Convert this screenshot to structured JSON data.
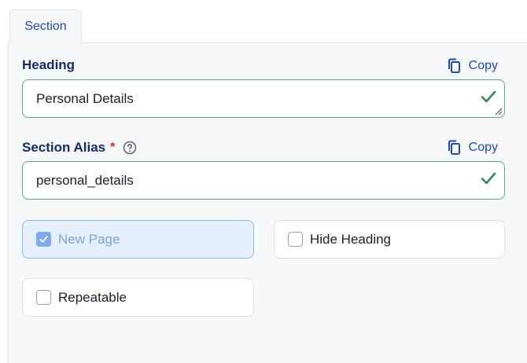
{
  "tabs": [
    {
      "label": "Section",
      "active": true
    }
  ],
  "heading_field": {
    "label": "Heading",
    "value": "Personal Details",
    "valid": true,
    "copy_label": "Copy"
  },
  "alias_field": {
    "label": "Section Alias",
    "required_marker": "*",
    "help_icon": "question-circle-icon",
    "value": "personal_details",
    "valid": true,
    "copy_label": "Copy"
  },
  "options": [
    {
      "label": "New Page",
      "checked": true
    },
    {
      "label": "Hide Heading",
      "checked": false
    },
    {
      "label": "Repeatable",
      "checked": false
    }
  ],
  "colors": {
    "accent": "#1f48c4",
    "label": "#162a6b",
    "valid_border": "#5fa884",
    "valid_check": "#2e8b57",
    "required": "#d13030",
    "checked_bg": "#e4f0fd",
    "checked_border": "#8bbcf0",
    "checkbox_fill": "#7aa9ee"
  }
}
